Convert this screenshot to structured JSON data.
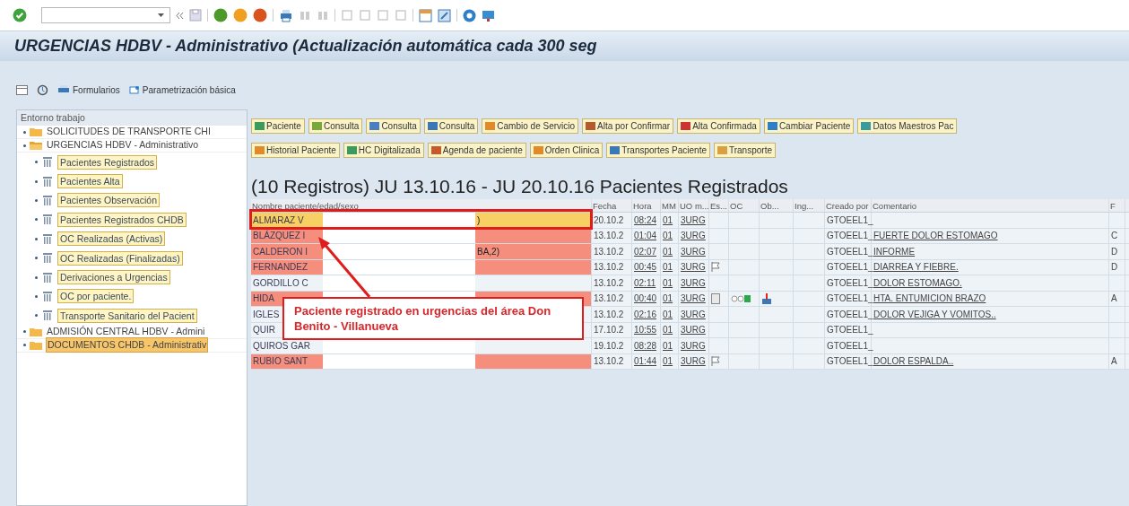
{
  "window": {
    "title": "URGENCIAS HDBV - Administrativo (Actualización automática cada 300 seg"
  },
  "app_toolbar": [
    {
      "label": "Formularios",
      "kind": "printer"
    },
    {
      "label": "Parametrización básica",
      "kind": "settings"
    }
  ],
  "sidebar": {
    "title": "Entorno trabajo",
    "items": [
      {
        "label": "SOLICITUDES DE TRANSPORTE CHI",
        "expanded": false,
        "selected": false
      },
      {
        "label": "URGENCIAS HDBV - Administrativo",
        "expanded": true,
        "selected": false,
        "children": [
          {
            "label": "Pacientes Registrados"
          },
          {
            "label": "Pacientes Alta"
          },
          {
            "label": "Pacientes Observación"
          },
          {
            "label": "Pacientes Registrados CHDB"
          },
          {
            "label": "OC Realizadas (Activas)"
          },
          {
            "label": "OC Realizadas (Finalizadas)"
          },
          {
            "label": "Derivaciones a Urgencias"
          },
          {
            "label": "OC por paciente."
          },
          {
            "label": "Transporte Sanitario del Pacient"
          }
        ]
      },
      {
        "label": "ADMISIÓN CENTRAL HDBV - Admini",
        "expanded": false,
        "selected": false
      },
      {
        "label": "DOCUMENTOS CHDB - Administrativ",
        "expanded": false,
        "selected": true
      }
    ]
  },
  "action_buttons": [
    [
      {
        "label": "Paciente"
      },
      {
        "label": "Consulta"
      },
      {
        "label": "Consulta"
      },
      {
        "label": "Consulta"
      },
      {
        "label": "Cambio de Servicio"
      },
      {
        "label": "Alta por Confirmar"
      },
      {
        "label": "Alta Confirmada"
      },
      {
        "label": "Cambiar Paciente"
      },
      {
        "label": "Datos Maestros Pac"
      }
    ],
    [
      {
        "label": "Historial Paciente"
      },
      {
        "label": "HC Digitalizada"
      },
      {
        "label": "Agenda de paciente"
      },
      {
        "label": "Orden Clinica"
      },
      {
        "label": "Transportes Paciente"
      },
      {
        "label": "Transporte"
      }
    ]
  ],
  "table": {
    "heading": "(10 Registros) JU 13.10.16 - JU 20.10.16 Pacientes Registrados",
    "columns": [
      "Nombre paciente/edad/sexo",
      "Fecha",
      "Hora",
      "MM",
      "UO m...",
      "Es...",
      "OC",
      "Ob...",
      "Ing...",
      "Creado por",
      "Comentario",
      "F"
    ],
    "rows": [
      {
        "name": "ALMARAZ V",
        "name_end": ")",
        "fecha": "20.10.2",
        "hora": "08:24",
        "mm": "01",
        "uo": "3URG",
        "creado": "GTOEEL1_",
        "selected": true
      },
      {
        "name": "BLÁZQUEZ I",
        "fecha": "13.10.2",
        "hora": "01:04",
        "mm": "01",
        "uo": "3URG",
        "creado": "GTOEEL1_",
        "comentario": "FUERTE DOLOR ESTOMAGO",
        "column_12": "C",
        "selected": false,
        "alert": true
      },
      {
        "name": "CALDERON I",
        "name_end": "BA,2)",
        "fecha": "13.10.2",
        "hora": "02:07",
        "mm": "01",
        "uo": "3URG",
        "creado": "GTOEEL1_",
        "comentario": "INFORME",
        "column_12": "D",
        "selected": false,
        "alert": true
      },
      {
        "name": "FERNANDEZ",
        "fecha": "13.10.2",
        "hora": "00:45",
        "mm": "01",
        "uo": "3URG",
        "es": {
          "kind": "flag"
        },
        "creado": "GTOEEL1_",
        "comentario": "DIARREA Y FIEBRE.",
        "column_12": "D",
        "selected": false,
        "alert": true
      },
      {
        "name": "GORDILLO C",
        "fecha": "13.10.2",
        "hora": "02:11",
        "mm": "01",
        "uo": "3URG",
        "creado": "GTOEEL1_",
        "comentario": "DOLOR ESTOMAGO.",
        "selected": false,
        "alert": false
      },
      {
        "name": "HIDA",
        "fecha": "13.10.2",
        "hora": "00:40",
        "mm": "01",
        "uo": "3URG",
        "es": {
          "kind": "note"
        },
        "oc": {
          "kind": "lights"
        },
        "ob": {
          "kind": "alarm"
        },
        "creado": "GTOEEL1_",
        "comentario": "HTA. ENTUMICION BRAZO",
        "column_12": "A",
        "selected": false,
        "alert": true
      },
      {
        "name": "IGLES",
        "fecha": "13.10.2",
        "hora": "02:16",
        "mm": "01",
        "uo": "3URG",
        "creado": "GTOEEL1_",
        "comentario": "DOLOR VEJIGA Y VOMITOS..",
        "selected": false,
        "alert": false
      },
      {
        "name": "QUIR",
        "fecha": "17.10.2",
        "hora": "10:55",
        "mm": "01",
        "uo": "3URG",
        "creado": "GTOEEL1_",
        "selected": false,
        "alert": false
      },
      {
        "name": "QUIROS GAR",
        "fecha": "19.10.2",
        "hora": "08:28",
        "mm": "01",
        "uo": "3URG",
        "creado": "GTOEEL1_",
        "selected": false,
        "alert": false
      },
      {
        "name": "RUBIO SANT",
        "fecha": "13.10.2",
        "hora": "01:44",
        "mm": "01",
        "uo": "3URG",
        "es": {
          "kind": "flag"
        },
        "creado": "GTOEEL1_",
        "comentario": "DOLOR ESPALDA..",
        "column_12": "A",
        "selected": false,
        "alert": true
      }
    ]
  },
  "callout": {
    "text": "Paciente registrado en urgencias del área Don Benito - Villanueva"
  }
}
